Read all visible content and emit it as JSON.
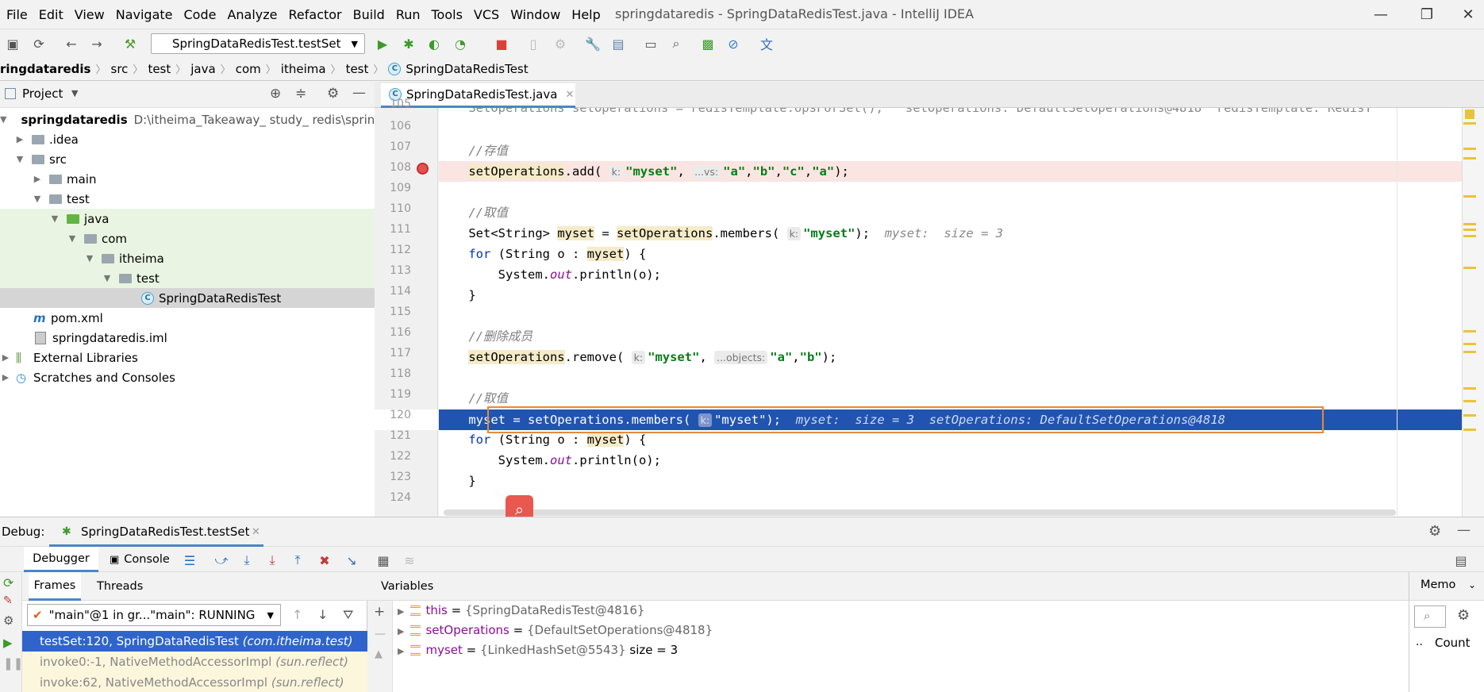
{
  "menu": [
    "File",
    "Edit",
    "View",
    "Navigate",
    "Code",
    "Analyze",
    "Refactor",
    "Build",
    "Run",
    "Tools",
    "VCS",
    "Window",
    "Help"
  ],
  "window_title": "springdataredis - SpringDataRedisTest.java - IntelliJ IDEA",
  "toolbar": {
    "run_config": "SpringDataRedisTest.testSet"
  },
  "breadcrumb": [
    "ringdataredis",
    "src",
    "test",
    "java",
    "com",
    "itheima",
    "test",
    "SpringDataRedisTest"
  ],
  "project": {
    "title": "Project",
    "tree": [
      {
        "label": "springdataredis",
        "path": "D:\\itheima_Takeaway_ study_ redis\\springd"
      },
      {
        "label": ".idea"
      },
      {
        "label": "src"
      },
      {
        "label": "main"
      },
      {
        "label": "test"
      },
      {
        "label": "java"
      },
      {
        "label": "com"
      },
      {
        "label": "itheima"
      },
      {
        "label": "test"
      },
      {
        "label": "SpringDataRedisTest"
      },
      {
        "label": "pom.xml"
      },
      {
        "label": "springdataredis.iml"
      },
      {
        "label": "External Libraries"
      },
      {
        "label": "Scratches and Consoles"
      }
    ]
  },
  "editor": {
    "tab": "SpringDataRedisTest.java",
    "line_numbers": [
      "106",
      "107",
      "108",
      "109",
      "110",
      "111",
      "112",
      "113",
      "114",
      "115",
      "116",
      "117",
      "118",
      "119",
      "120",
      "121",
      "122",
      "123",
      "124"
    ],
    "top_partial": "SetOperations setOperations = redisTemplate.opsForSet();   setOperations: DefaultSetOperations@4818  redisTemplate: RedisT",
    "cmt_store": "//存值",
    "cmt_get": "//取值",
    "cmt_remove": "//删除成员",
    "cmt_get2": "//取值",
    "hint_k": "k:",
    "hint_vs": "...vs:",
    "hint_objects": "...objects:",
    "inline_myset": "myset:  size = 3",
    "inline_exec": "myset:  size = 3  setOperations: DefaultSetOperations@4818"
  },
  "debug": {
    "label": "Debug:",
    "session": "SpringDataRedisTest.testSet",
    "tabs": {
      "debugger": "Debugger",
      "console": "Console"
    },
    "frames_tab": "Frames",
    "threads_tab": "Threads",
    "thread": "\"main\"@1 in gr...\"main\": RUNNING",
    "frames": [
      {
        "method": "testSet:120, SpringDataRedisTest",
        "pkg": "(com.itheima.test)"
      },
      {
        "method": "invoke0:-1, NativeMethodAccessorImpl",
        "pkg": "(sun.reflect)"
      },
      {
        "method": "invoke:62, NativeMethodAccessorImpl",
        "pkg": "(sun.reflect)"
      }
    ],
    "variables_title": "Variables",
    "variables": [
      {
        "name": "this",
        "value": "{SpringDataRedisTest@4816}",
        "extra": ""
      },
      {
        "name": "setOperations",
        "value": "{DefaultSetOperations@4818}",
        "extra": ""
      },
      {
        "name": "myset",
        "value": "{LinkedHashSet@5543}",
        "extra": "size = 3"
      }
    ],
    "memory_tab": "Memo",
    "count_label": "Count"
  }
}
